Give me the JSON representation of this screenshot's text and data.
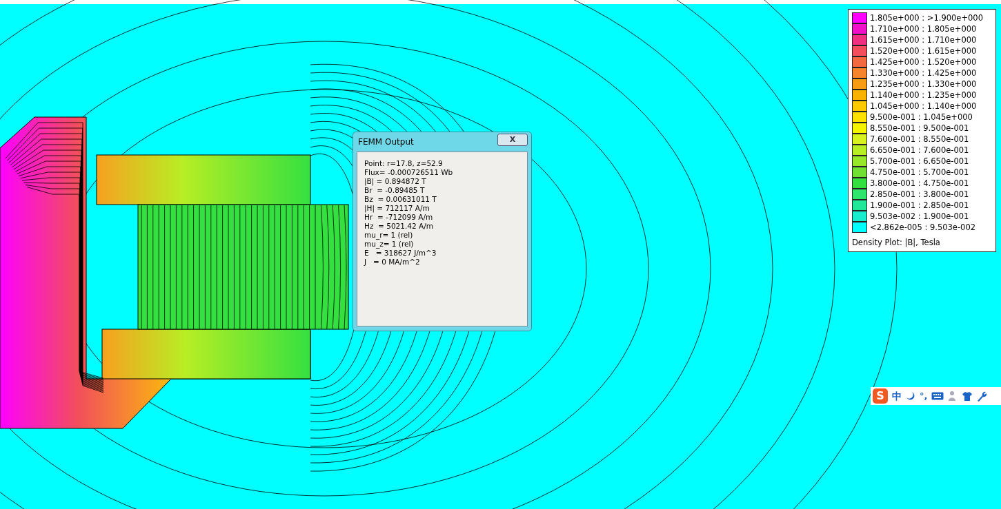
{
  "legend": {
    "title": "Density Plot: |B|, Tesla",
    "items": [
      {
        "label": "1.805e+000 : >1.900e+000",
        "color": "#ff00ff"
      },
      {
        "label": "1.710e+000 : 1.805e+000",
        "color": "#f010c8"
      },
      {
        "label": "1.615e+000 : 1.710e+000",
        "color": "#f03080"
      },
      {
        "label": "1.520e+000 : 1.615e+000",
        "color": "#f24e5c"
      },
      {
        "label": "1.425e+000 : 1.520e+000",
        "color": "#f46a40"
      },
      {
        "label": "1.330e+000 : 1.425e+000",
        "color": "#f6842a"
      },
      {
        "label": "1.235e+000 : 1.330e+000",
        "color": "#f89c14"
      },
      {
        "label": "1.140e+000 : 1.235e+000",
        "color": "#fab200"
      },
      {
        "label": "1.045e+000 : 1.140e+000",
        "color": "#fcca00"
      },
      {
        "label": "9.500e-001 : 1.045e+000",
        "color": "#fde200"
      },
      {
        "label": "8.550e-001 : 9.500e-001",
        "color": "#f4f400"
      },
      {
        "label": "7.600e-001 : 8.550e-001",
        "color": "#d8f220"
      },
      {
        "label": "6.650e-001 : 7.600e-001",
        "color": "#b8ee24"
      },
      {
        "label": "5.700e-001 : 6.650e-001",
        "color": "#98e82a"
      },
      {
        "label": "4.750e-001 : 5.700e-001",
        "color": "#70e032"
      },
      {
        "label": "3.800e-001 : 4.750e-001",
        "color": "#34e040"
      },
      {
        "label": "2.850e-001 : 3.800e-001",
        "color": "#2ee66c"
      },
      {
        "label": "1.900e-001 : 2.850e-001",
        "color": "#20e898"
      },
      {
        "label": "9.503e-002 : 1.900e-001",
        "color": "#18eccc"
      },
      {
        "label": "<2.862e-005 : 9.503e-002",
        "color": "#00ffff"
      }
    ]
  },
  "dialog": {
    "title": "FEMM Output",
    "close": "X",
    "lines": [
      "Point: r=17.8, z=52.9",
      "Flux= -0.000726511 Wb",
      "|B| = 0.894872 T",
      "Br  = -0.89485 T",
      "Bz  = 0.00631011 T",
      "|H| = 712117 A/m",
      "Hr  = -712099 A/m",
      "Hz  = 5021.42 A/m",
      "mu_r= 1 (rel)",
      "mu_z= 1 (rel)",
      "E   = 318627 J/m^3",
      "J   = 0 MA/m^2"
    ]
  },
  "ime_toolbar": {
    "logo": "S",
    "mode": "中",
    "punctuation": "°,"
  }
}
